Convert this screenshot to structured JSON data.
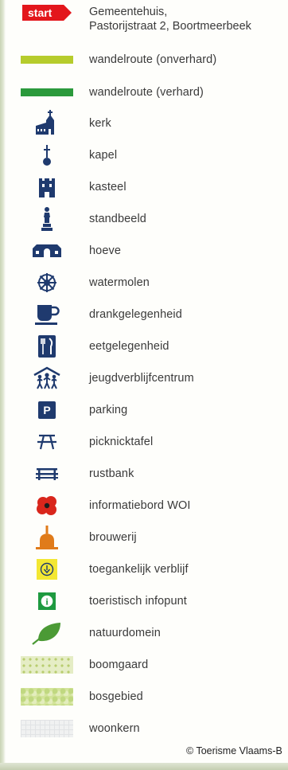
{
  "legend": {
    "start": {
      "badge": "start",
      "line1": "Gemeentehuis,",
      "line2": "Pastorijstraat 2, Boortmeerbeek"
    },
    "items": [
      {
        "label": "wandelroute (onverhard)",
        "icon": "light-green-line"
      },
      {
        "label": "wandelroute (verhard)",
        "icon": "dark-green-line"
      },
      {
        "label": "kerk",
        "icon": "church-icon"
      },
      {
        "label": "kapel",
        "icon": "chapel-icon"
      },
      {
        "label": "kasteel",
        "icon": "castle-icon"
      },
      {
        "label": "standbeeld",
        "icon": "statue-icon"
      },
      {
        "label": "hoeve",
        "icon": "farm-icon"
      },
      {
        "label": "watermolen",
        "icon": "watermill-icon"
      },
      {
        "label": "drankgelegenheid",
        "icon": "cup-icon"
      },
      {
        "label": "eetgelegenheid",
        "icon": "cutlery-icon"
      },
      {
        "label": "jeugdverblijfcentrum",
        "icon": "youth-hostel-icon"
      },
      {
        "label": "parking",
        "icon": "parking-icon",
        "glyph": "P"
      },
      {
        "label": "picknicktafel",
        "icon": "picnic-table-icon"
      },
      {
        "label": "rustbank",
        "icon": "bench-icon"
      },
      {
        "label": "informatiebord WOI",
        "icon": "poppy-icon"
      },
      {
        "label": "brouwerij",
        "icon": "brewery-icon"
      },
      {
        "label": "toegankelijk verblijf",
        "icon": "accessible-stay-icon"
      },
      {
        "label": "toeristisch infopunt",
        "icon": "info-icon",
        "glyph": "i"
      },
      {
        "label": "natuurdomein",
        "icon": "leaf-icon"
      },
      {
        "label": "boomgaard",
        "icon": "orchard-swatch"
      },
      {
        "label": "bosgebied",
        "icon": "forest-swatch"
      },
      {
        "label": "woonkern",
        "icon": "urban-swatch"
      }
    ]
  },
  "copyright": "© Toerisme Vlaams-B",
  "colors": {
    "start_red": "#e3161c",
    "route_unpaved": "#b6cc2c",
    "route_paved": "#2b9a3c",
    "icon_navy": "#1f3a6e",
    "info_green": "#1e9a40",
    "poppy_red": "#d9261c",
    "brewery_orange": "#e07b1a",
    "access_yellow": "#f3e733",
    "leaf_green": "#4b9a35"
  }
}
